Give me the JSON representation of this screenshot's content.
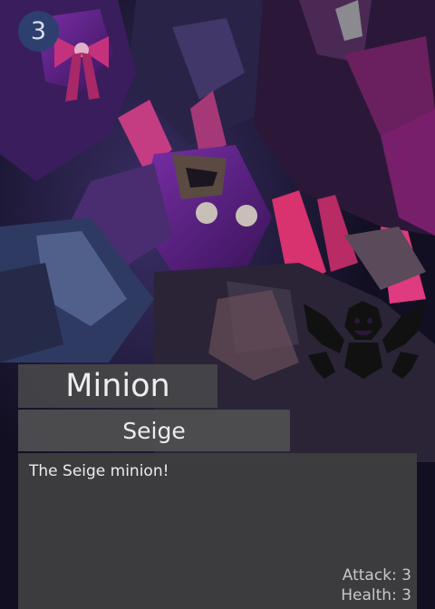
{
  "card": {
    "cost": "3",
    "name": "Minion",
    "type": "Seige",
    "description": "The Seige minion!",
    "stats": {
      "attack_label": "Attack:",
      "attack_value": "3",
      "health_label": "Health:",
      "health_value": "3"
    },
    "emblem_icon": "faction-emblem-icon",
    "colors": {
      "cost_badge": "#2d3f6e",
      "panel": "#444446",
      "text": "#ececec"
    }
  }
}
